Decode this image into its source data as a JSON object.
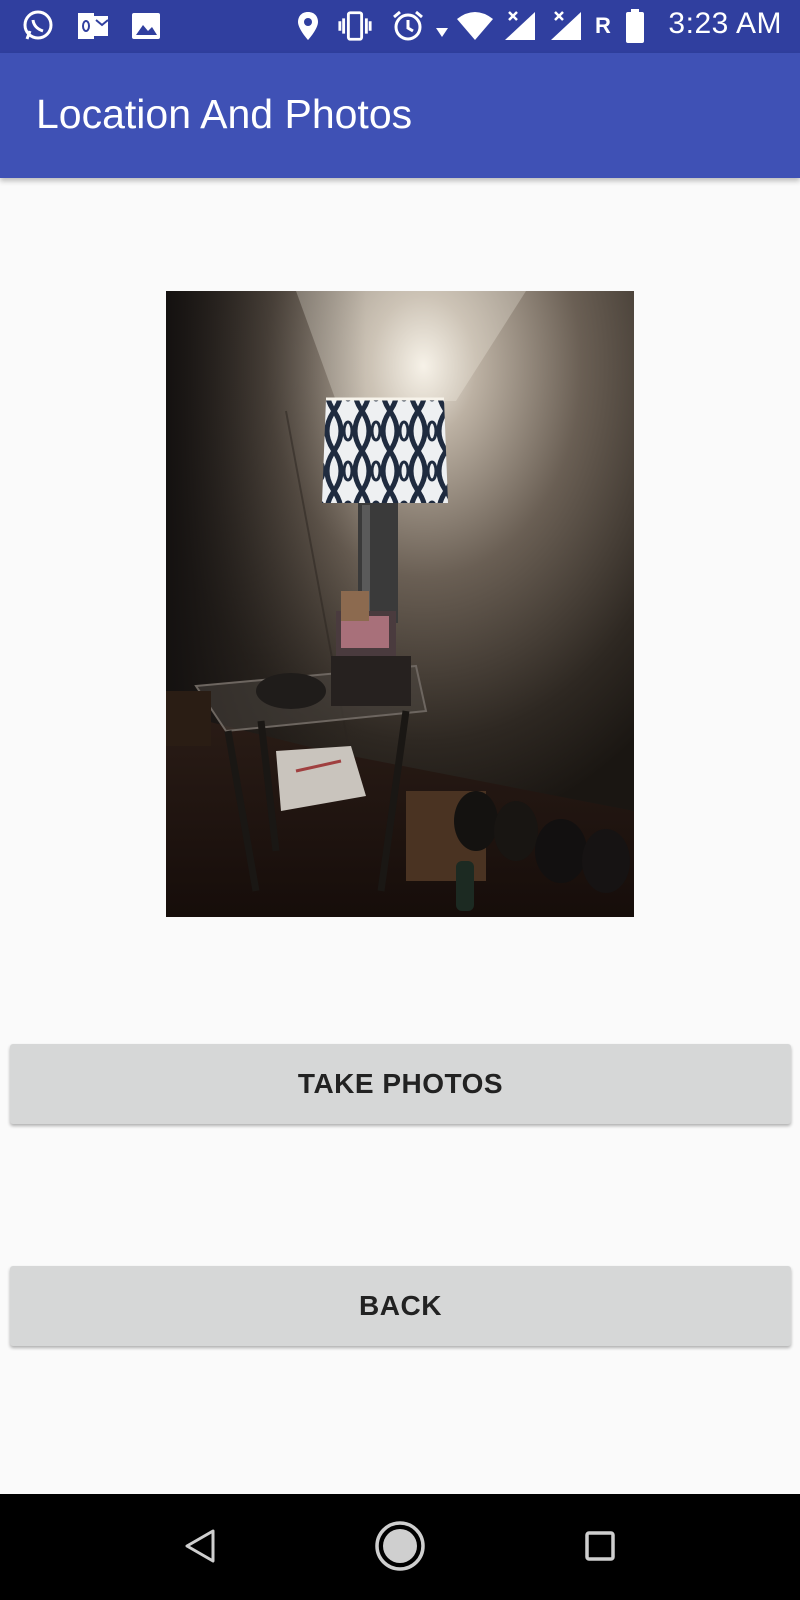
{
  "status_bar": {
    "time": "3:23 AM",
    "carrier_indicator": "R",
    "icons": [
      "whatsapp-icon",
      "outlook-icon",
      "gallery-icon",
      "location-icon",
      "vibrate-icon",
      "alarm-icon",
      "wifi-icon",
      "signal-icon",
      "signal-icon",
      "battery-icon"
    ]
  },
  "app_bar": {
    "title": "Location And Photos"
  },
  "photo": {
    "subject": "lamp-photo"
  },
  "buttons": {
    "take_photos": "TAKE PHOTOS",
    "back": "BACK"
  },
  "nav_bar": {
    "icons": [
      "back-nav-icon",
      "home-nav-icon",
      "recents-nav-icon"
    ]
  },
  "colors": {
    "status_bar": "#303f9f",
    "app_bar": "#3f51b5",
    "background": "#fafafa",
    "button": "#d6d7d7"
  }
}
